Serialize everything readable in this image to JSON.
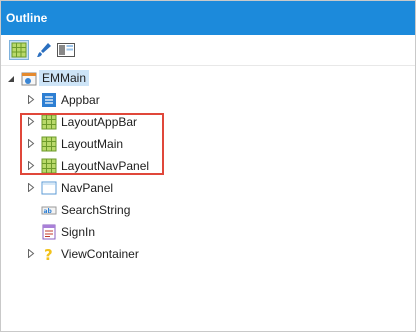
{
  "panel": {
    "title": "Outline"
  },
  "toolbar": {
    "buttons": [
      {
        "icon": "grid-view-icon",
        "active": true
      },
      {
        "icon": "brush-icon",
        "active": false
      },
      {
        "icon": "layout-preview-icon",
        "active": false
      }
    ]
  },
  "tree": {
    "root": {
      "label": "EMMain",
      "icon": "root-component-icon",
      "expanded": true
    },
    "items": [
      {
        "label": "Appbar",
        "icon": "appbar-icon",
        "has_children": true
      },
      {
        "label": "LayoutAppBar",
        "icon": "grid-layout-icon",
        "has_children": true
      },
      {
        "label": "LayoutMain",
        "icon": "grid-layout-icon",
        "has_children": true
      },
      {
        "label": "LayoutNavPanel",
        "icon": "grid-layout-icon",
        "has_children": true
      },
      {
        "label": "NavPanel",
        "icon": "panel-icon",
        "has_children": true
      },
      {
        "label": "SearchString",
        "icon": "search-string-icon",
        "has_children": false
      },
      {
        "label": "SignIn",
        "icon": "form-icon",
        "has_children": false
      },
      {
        "label": "ViewContainer",
        "icon": "question-mark-icon",
        "has_children": true
      }
    ]
  },
  "colors": {
    "titlebar": "#1c8adb",
    "highlight_border": "#e0473a",
    "selection": "#cde4f7"
  }
}
